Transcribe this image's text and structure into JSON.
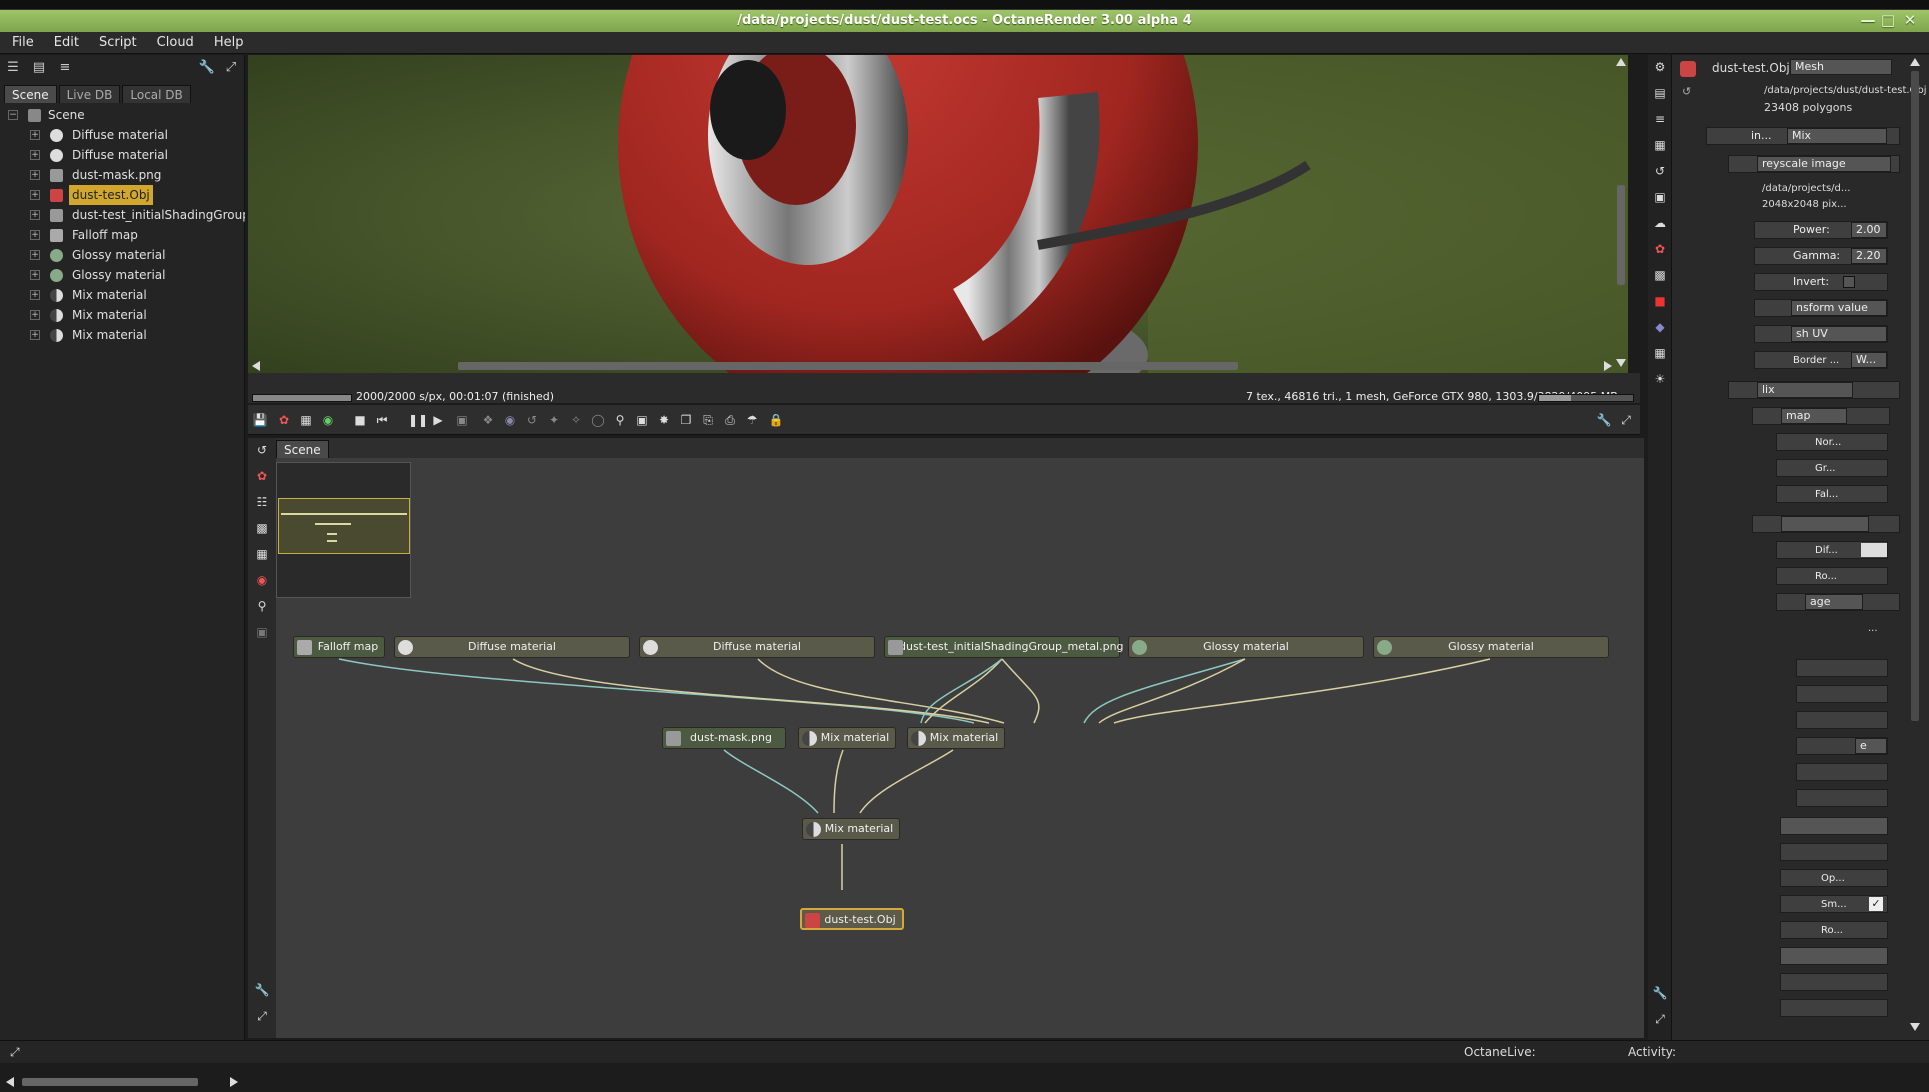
{
  "window": {
    "title": "/data/projects/dust/dust-test.ocs - OctaneRender 3.00 alpha 4"
  },
  "menu": [
    "File",
    "Edit",
    "Script",
    "Cloud",
    "Help"
  ],
  "left_panel": {
    "tabs": [
      "Scene",
      "Live DB",
      "Local DB"
    ],
    "tree_root": "Scene",
    "tree_items": [
      {
        "label": "Diffuse material",
        "icon": "diffuse-material-icon"
      },
      {
        "label": "Diffuse material",
        "icon": "diffuse-material-icon"
      },
      {
        "label": "dust-mask.png",
        "icon": "image-texture-icon"
      },
      {
        "label": "dust-test.Obj",
        "icon": "mesh-icon"
      },
      {
        "label": "dust-test_initialShadingGroup_me",
        "icon": "image-texture-icon"
      },
      {
        "label": "Falloff map",
        "icon": "falloff-map-icon"
      },
      {
        "label": "Glossy material",
        "icon": "glossy-material-icon"
      },
      {
        "label": "Glossy material",
        "icon": "glossy-material-icon"
      },
      {
        "label": "Mix material",
        "icon": "mix-material-icon"
      },
      {
        "label": "Mix material",
        "icon": "mix-material-icon"
      },
      {
        "label": "Mix material",
        "icon": "mix-material-icon"
      }
    ]
  },
  "viewport": {
    "render_status": "2000/2000 s/px, 00:01:07 (finished)",
    "scene_stats": "7 tex., 46816 tri., 1 mesh, GeForce GTX 980, 1303.9/3829/4095 MB"
  },
  "graph": {
    "tab": "Scene",
    "nodes": {
      "falloff": "Falloff map",
      "diffuse1": "Diffuse material",
      "diffuse2": "Diffuse material",
      "shading_png": "dust-test_initialShadingGroup_metal.png",
      "glossy1": "Glossy material",
      "glossy2": "Glossy material",
      "dust_mask": "dust-mask.png",
      "mix1": "Mix material",
      "mix2": "Mix material",
      "mix_final": "Mix material",
      "obj": "dust-test.Obj"
    }
  },
  "right_panel": {
    "object_name": "dust-test.Obj",
    "object_type": "Mesh",
    "file_path": "/data/projects/dust/dust-test.Obj",
    "polygons": "23408 polygons",
    "mix_row_short": "in...",
    "mix_type": "Mix",
    "greyscale": "reyscale image",
    "image_path": "/data/projects/d...",
    "image_size": "2048x2048 pix...",
    "power_label": "Power:",
    "power_value": "2.00",
    "gamma_label": "Gamma:",
    "gamma_value": "2.20",
    "invert_label": "Invert:",
    "transform_label": "nsform value",
    "uv_label": "sh UV",
    "border_label": "Border ...",
    "border_value": "W...",
    "mix2_label": "lix",
    "map_label": "map",
    "nor_label": "Nor...",
    "gr_label": "Gr...",
    "fal_label": "Fal...",
    "dif_label": "Dif...",
    "ro_label": "Ro...",
    "age_label": "age",
    "e_label": "e",
    "op_label": "Op...",
    "sm_label": "Sm...",
    "ro2_label": "Ro...",
    "dots": "..."
  },
  "status": {
    "octane_live": "OctaneLive:",
    "activity": "Activity:"
  }
}
